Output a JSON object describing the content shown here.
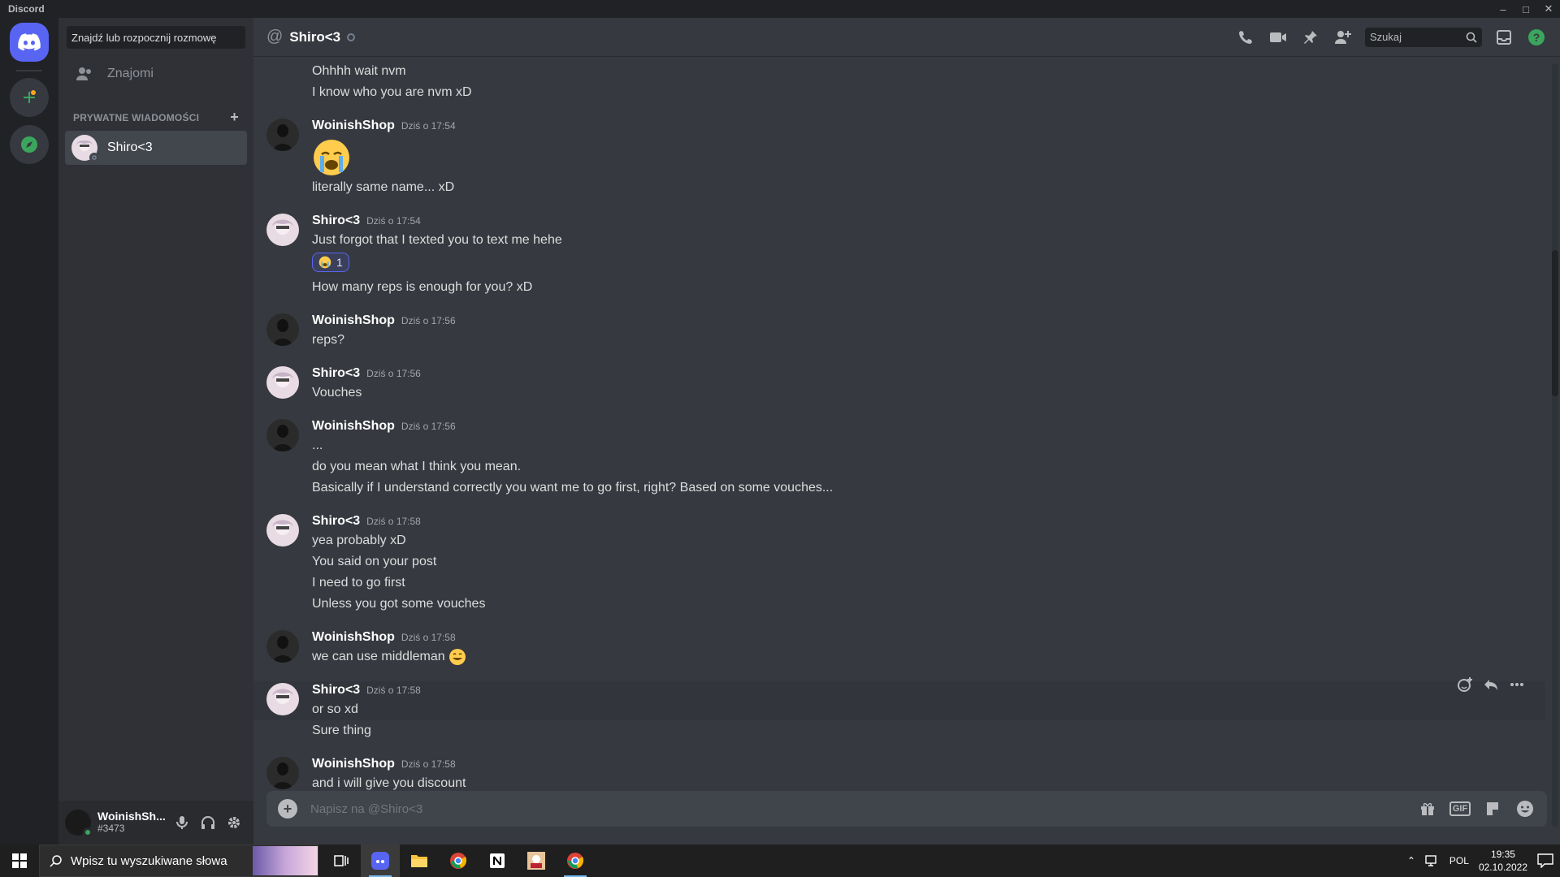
{
  "window": {
    "title": "Discord"
  },
  "sidebar": {
    "search_placeholder": "Znajdź lub rozpocznij rozmowę",
    "friends_label": "Znajomi",
    "dm_header": "PRYWATNE WIADOMOŚCI",
    "dms": [
      {
        "name": "Shiro<3"
      }
    ]
  },
  "user_panel": {
    "name": "WoinishSh...",
    "tag": "#3473"
  },
  "channel": {
    "name": "Shiro<3",
    "search_placeholder": "Szukaj"
  },
  "messages": [
    {
      "continuation": [
        "Ohhhh wait nvm",
        "I know who you are nvm xD"
      ]
    },
    {
      "author": "WoinishShop",
      "time": "Dziś o 17:54",
      "big_emoji": "crying-emoji",
      "lines": [
        "literally same name... xD"
      ]
    },
    {
      "author": "Shiro<3",
      "time": "Dziś o 17:54",
      "lines": [
        "Just forgot that I texted you to text me hehe"
      ],
      "reaction": {
        "emoji": "crying-emoji",
        "count": "1"
      },
      "after": [
        "How many reps is enough for you? xD"
      ]
    },
    {
      "author": "WoinishShop",
      "time": "Dziś o 17:56",
      "lines": [
        "reps?"
      ]
    },
    {
      "author": "Shiro<3",
      "time": "Dziś o 17:56",
      "lines": [
        "Vouches"
      ]
    },
    {
      "author": "WoinishShop",
      "time": "Dziś o 17:56",
      "lines": [
        "...",
        "do you mean what I think you mean.",
        "Basically if I understand correctly you want me to go first, right? Based on some vouches..."
      ]
    },
    {
      "author": "Shiro<3",
      "time": "Dziś o 17:58",
      "lines": [
        "yea probably xD",
        "You said on your post",
        "I need to go first",
        "Unless you got some vouches"
      ]
    },
    {
      "author": "WoinishShop",
      "time": "Dziś o 17:58",
      "lines": [
        "we can use middleman"
      ]
    },
    {
      "author": "Shiro<3",
      "time": "Dziś o 17:58",
      "lines": [
        "or so xd",
        "Sure thing"
      ]
    },
    {
      "author": "WoinishShop",
      "time": "Dziś o 17:58",
      "lines": [
        "and i will give you discount"
      ]
    }
  ],
  "composer": {
    "placeholder": "Napisz na @Shiro<3",
    "gif_label": "GIF"
  },
  "taskbar": {
    "search_placeholder": "Wpisz tu wyszukiwane słowa",
    "lang": "POL",
    "time": "19:35",
    "date": "02.10.2022"
  },
  "colors": {
    "blurple": "#5865f2",
    "online": "#3ba55d",
    "bg_main": "#36393f",
    "bg_sidebar": "#2f3136"
  }
}
